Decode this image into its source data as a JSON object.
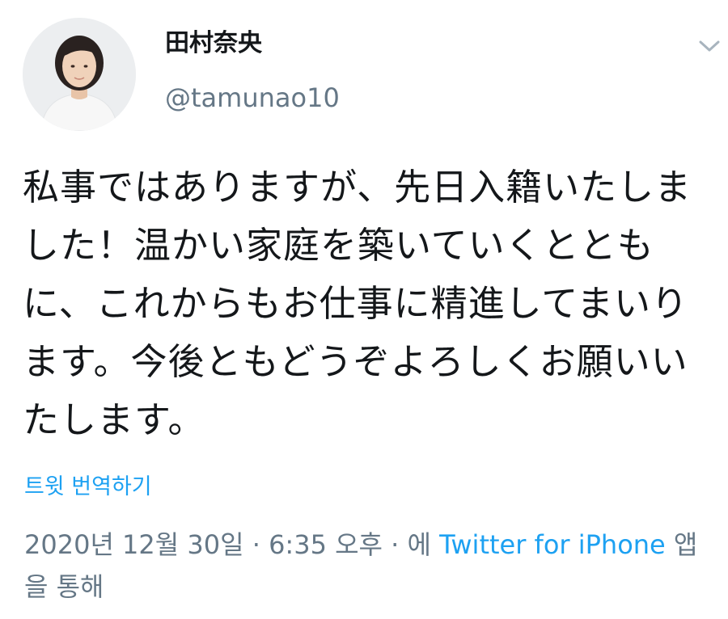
{
  "author": {
    "display_name": "田村奈央",
    "handle": "@tamunao10",
    "avatar_icon": "profile-photo"
  },
  "tweet": {
    "text": "私事ではありますが、先日入籍いたしました！温かい家庭を築いていくとともに、これからもお仕事に精進してまいります。今後ともどうぞよろしくお願いいたします。",
    "translate_label": "트윗 번역하기"
  },
  "meta": {
    "date": "2020년 12월 30일",
    "separator1": " · ",
    "time": "6:35 오후",
    "separator2": " · ",
    "via_prefix": "에 ",
    "source": "Twitter for iPhone",
    "via_suffix": " 앱을 통해"
  },
  "colors": {
    "accent": "#1da1f2",
    "secondary_text": "#657786",
    "primary_text": "#14171a"
  },
  "icons": {
    "menu": "chevron-down-icon"
  }
}
